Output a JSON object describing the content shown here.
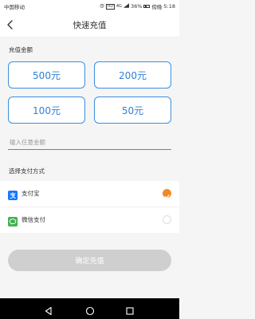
{
  "status_bar": {
    "carrier": "中国移动",
    "hd": "HD",
    "network": "4G",
    "battery": "36%",
    "time_prefix": "傍晚",
    "time": "5:18"
  },
  "nav": {
    "title": "快速充值",
    "back_icon": "back-arrow-icon"
  },
  "amount_section": {
    "label": "充值金额",
    "options": [
      "500元",
      "200元",
      "100元",
      "50元"
    ],
    "custom_placeholder": "输入任意金额",
    "custom_value": ""
  },
  "payment_section": {
    "label": "选择支付方式",
    "methods": [
      {
        "label": "支付宝",
        "icon": "alipay-icon",
        "selected": true,
        "color": "#1677ff"
      },
      {
        "label": "微信支付",
        "icon": "wechat-pay-icon",
        "selected": false,
        "color": "#3fb24f"
      }
    ]
  },
  "confirm": {
    "label": "确定充值",
    "enabled": false
  },
  "colors": {
    "accent": "#3a8fe0",
    "selected_radio": "#f08a24",
    "disabled_button": "#cfcfcf"
  }
}
